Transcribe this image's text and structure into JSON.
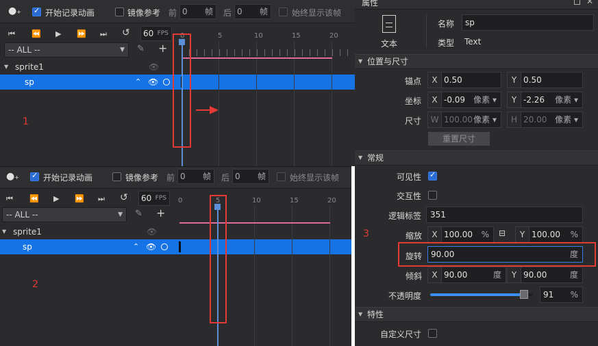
{
  "timeline": {
    "record_label": "开始记录动画",
    "mirror_label": "镜像参考",
    "prev_label": "前",
    "prev_value": "0",
    "frame_unit": "帧",
    "next_label": "后",
    "next_value": "0",
    "always_show_label": "始终显示该帧",
    "fps_value": "60",
    "fps_unit": "FPS",
    "filter_value": "-- ALL --",
    "ruler_ticks": [
      "0",
      "5",
      "10",
      "15",
      "20"
    ],
    "tree": [
      {
        "label": "sprite1"
      },
      {
        "label": "sp"
      }
    ]
  },
  "annotations": {
    "step1": "1",
    "step2": "2",
    "step3": "3"
  },
  "props": {
    "panel_title": "属性",
    "node_type_label": "文本",
    "name_label": "名称",
    "name_value": "sp",
    "type_label": "类型",
    "type_value": "Text",
    "sections": {
      "pos": "位置与尺寸",
      "general": "常规",
      "feature": "特性"
    },
    "anchor_label": "锚点",
    "anchor_x": "0.50",
    "anchor_y": "0.50",
    "coord_label": "坐标",
    "coord_x": "-0.09",
    "coord_y": "-2.26",
    "pixel_unit": "像素",
    "size_label": "尺寸",
    "size_w": "100.00",
    "size_h": "20.00",
    "reset_size_label": "重置尺寸",
    "visible_label": "可见性",
    "interact_label": "交互性",
    "logic_tag_label": "逻辑标签",
    "logic_tag_value": "351",
    "scale_label": "缩放",
    "scale_x": "100.00",
    "scale_y": "100.00",
    "percent_unit": "%",
    "rotate_label": "旋转",
    "rotate_value": "90.00",
    "degree_unit": "度",
    "skew_label": "倾斜",
    "skew_x": "90.00",
    "skew_y": "90.00",
    "opacity_label": "不透明度",
    "opacity_value": "91",
    "opacity_fraction": 0.91,
    "custom_size_label": "自定义尺寸"
  }
}
